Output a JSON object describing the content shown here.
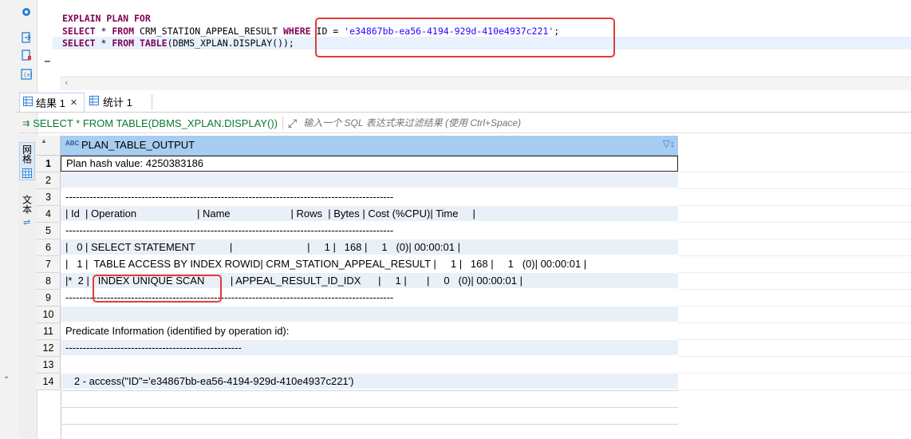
{
  "editor": {
    "line1": {
      "kw1": "EXPLAIN PLAN FOR"
    },
    "line2": {
      "kw1": "SELECT",
      "t1": " * ",
      "kw2": "FROM",
      "t2": " CRM_STATION_APPEAL_RESULT ",
      "kw3": "WHERE",
      "t3": " ID = ",
      "str": "'e34867bb-ea56-4194-929d-410e4937c221'",
      "t4": ";"
    },
    "line3": {
      "kw1": "SELECT",
      "t1": " * ",
      "kw2": "FROM",
      "t2": " ",
      "kw3": "TABLE",
      "t3": "(DBMS_XPLAN.DISPLAY());"
    },
    "cursor_line": "_"
  },
  "tabs": [
    {
      "label": "结果 1",
      "close": "✕"
    },
    {
      "label": "统计 1"
    }
  ],
  "filter": {
    "query": "SELECT * FROM TABLE(DBMS_XPLAN.DISPLAY())",
    "placeholder": "输入一个 SQL 表达式来过滤结果 (使用 Ctrl+Space)"
  },
  "side_tabs": {
    "grid": "网格",
    "text": "文本"
  },
  "grid": {
    "column_type": "ABC",
    "column_header": "PLAN_TABLE_OUTPUT",
    "rows": [
      {
        "n": "1",
        "v": "Plan hash value: 4250383186"
      },
      {
        "n": "2",
        "v": ""
      },
      {
        "n": "3",
        "v": "-----------------------------------------------------------------------------------------------"
      },
      {
        "n": "4",
        "v": "| Id  | Operation                     | Name                     | Rows  | Bytes | Cost (%CPU)| Time     |"
      },
      {
        "n": "5",
        "v": "-----------------------------------------------------------------------------------------------"
      },
      {
        "n": "6",
        "v": "|   0 | SELECT STATEMENT            |                          |     1 |   168 |     1   (0)| 00:00:01 |"
      },
      {
        "n": "7",
        "v": "|   1 |  TABLE ACCESS BY INDEX ROWID| CRM_STATION_APPEAL_RESULT |     1 |   168 |     1   (0)| 00:00:01 |"
      },
      {
        "n": "8",
        "v": "|*  2 |   INDEX UNIQUE SCAN         | APPEAL_RESULT_ID_IDX      |     1 |       |     0   (0)| 00:00:01 |"
      },
      {
        "n": "9",
        "v": "-----------------------------------------------------------------------------------------------"
      },
      {
        "n": "10",
        "v": ""
      },
      {
        "n": "11",
        "v": "Predicate Information (identified by operation id):"
      },
      {
        "n": "12",
        "v": "---------------------------------------------------"
      },
      {
        "n": "13",
        "v": ""
      },
      {
        "n": "14",
        "v": "   2 - access(\"ID\"='e34867bb-ea56-4194-929d-410e4937c221')"
      }
    ]
  },
  "colors": {
    "keyword": "#7f0055",
    "string": "#2a00ff",
    "header": "#a7cdf0",
    "highlight_box": "#e23b3b",
    "filter_text": "#0a7a2f"
  },
  "icons": [
    "settings-icon",
    "export-icon",
    "new-script-icon",
    "variables-icon",
    "grid-table-icon",
    "filter-icon",
    "expand-icon",
    "column-filter-icon"
  ]
}
